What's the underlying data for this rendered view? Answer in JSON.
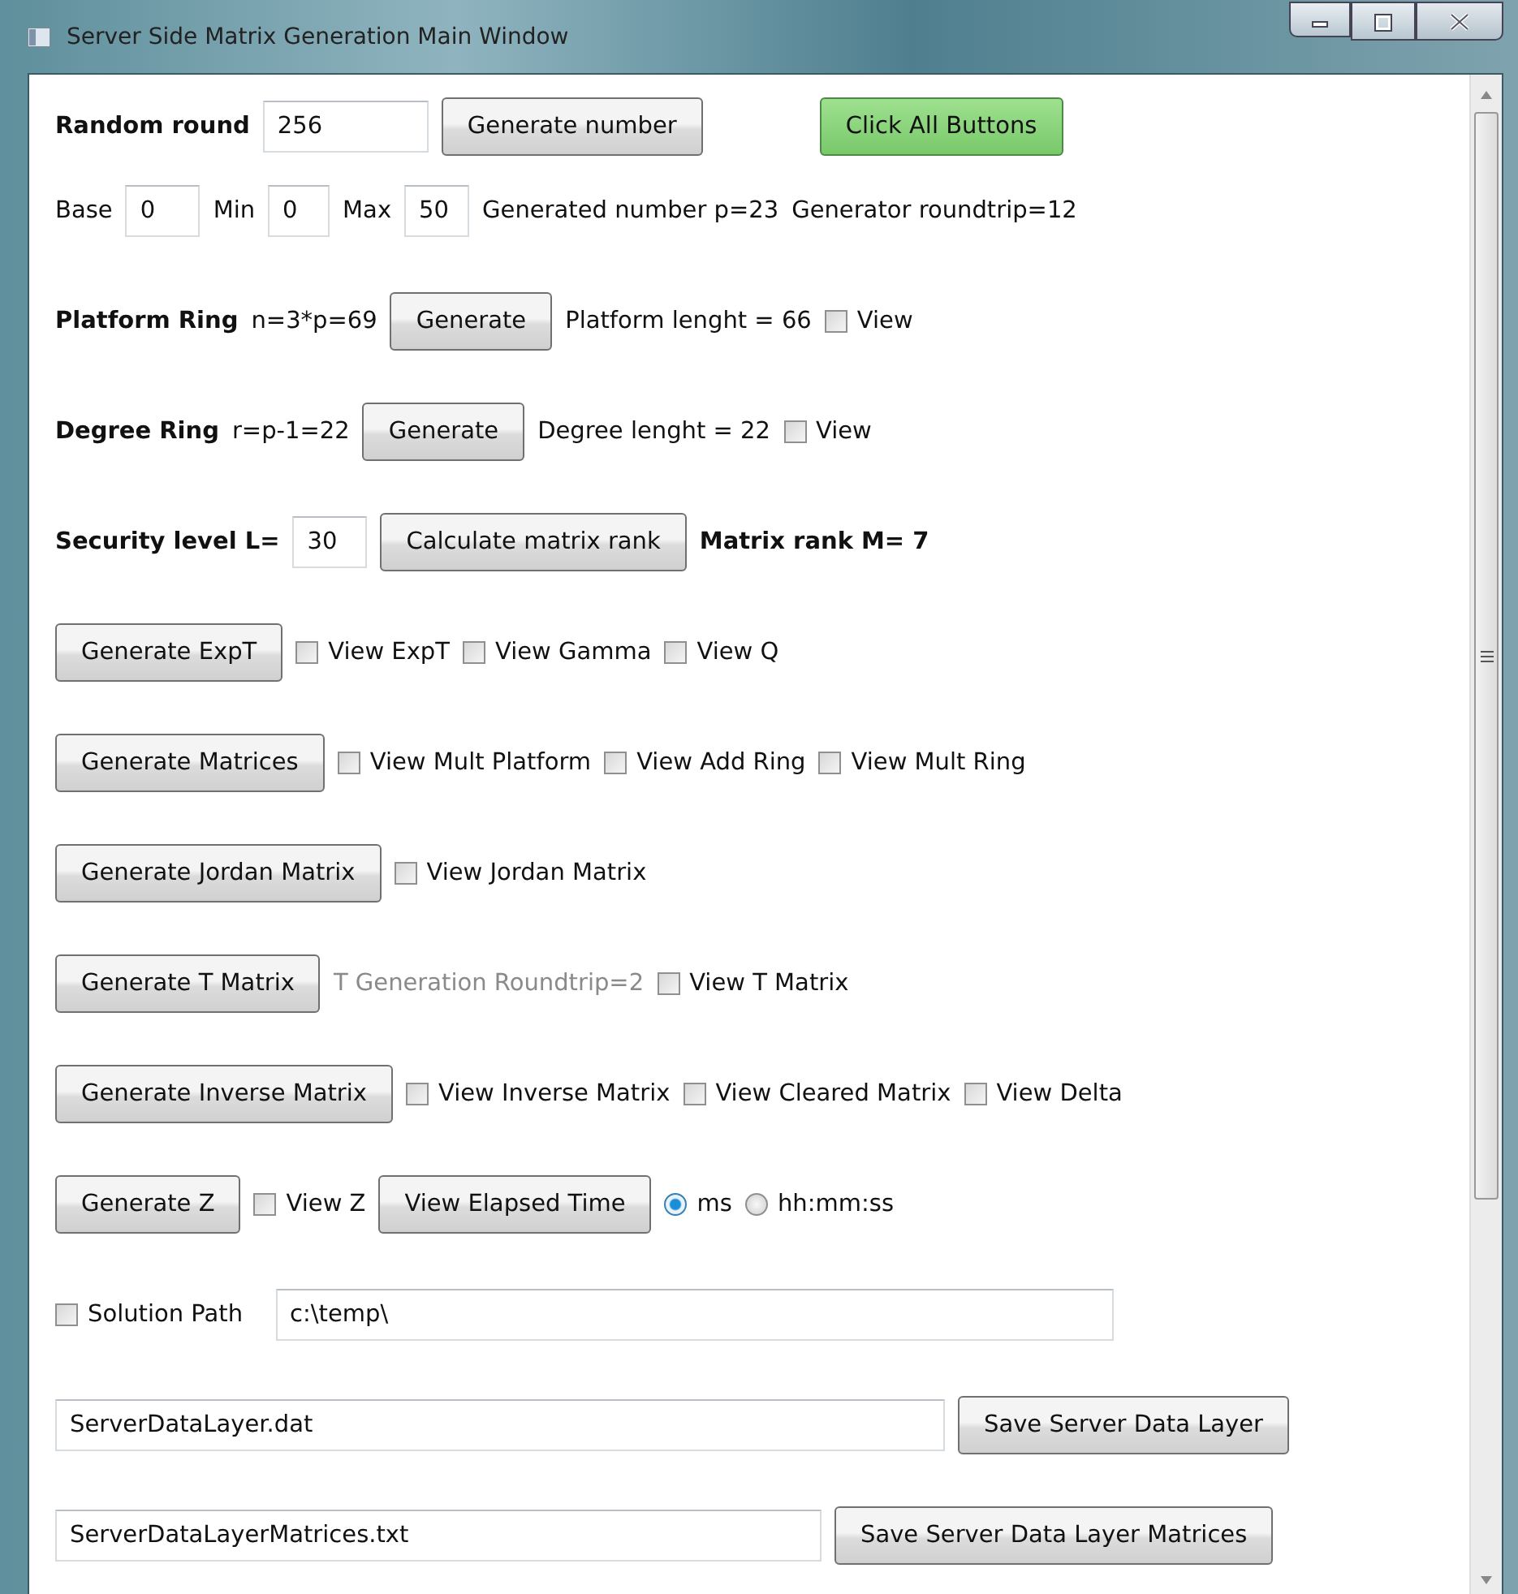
{
  "window": {
    "title": "Server Side Matrix Generation Main Window"
  },
  "rows": [
    {
      "items": [
        {
          "kind": "heading",
          "text": "Random round"
        },
        {
          "kind": "field",
          "value": "256"
        },
        {
          "kind": "button",
          "label": "Generate number"
        },
        {
          "kind": "accent-button",
          "label": "Click All Buttons"
        }
      ]
    },
    {
      "items": [
        {
          "kind": "text",
          "text": "Base"
        },
        {
          "kind": "field",
          "value": "0"
        },
        {
          "kind": "text",
          "text": "Min"
        },
        {
          "kind": "field",
          "value": "0"
        },
        {
          "kind": "text",
          "text": "Max"
        },
        {
          "kind": "field",
          "value": "50"
        },
        {
          "kind": "text",
          "text": "Generated number p=23"
        },
        {
          "kind": "text",
          "text": "Generator roundtrip=12"
        }
      ]
    },
    {
      "items": [
        {
          "kind": "heading",
          "text": "Platform Ring"
        },
        {
          "kind": "text",
          "text": "n=3*p=69"
        },
        {
          "kind": "button",
          "label": "Generate"
        },
        {
          "kind": "text",
          "text": "Platform lenght = 66"
        },
        {
          "kind": "checkbox",
          "label": "View",
          "checked": false
        }
      ]
    },
    {
      "items": [
        {
          "kind": "heading",
          "text": "Degree Ring"
        },
        {
          "kind": "text",
          "text": "r=p-1=22"
        },
        {
          "kind": "button",
          "label": "Generate"
        },
        {
          "kind": "text",
          "text": "Degree lenght = 22"
        },
        {
          "kind": "checkbox",
          "label": "View",
          "checked": false
        }
      ]
    },
    {
      "items": [
        {
          "kind": "heading",
          "text": "Security level L="
        },
        {
          "kind": "field",
          "value": "30"
        },
        {
          "kind": "button",
          "label": "Calculate matrix rank"
        },
        {
          "kind": "heading",
          "text": "Matrix rank M= 7"
        }
      ]
    },
    {
      "items": [
        {
          "kind": "button",
          "label": "Generate ExpT"
        },
        {
          "kind": "checkbox",
          "label": "View ExpT",
          "checked": false
        },
        {
          "kind": "checkbox",
          "label": "View Gamma",
          "checked": false
        },
        {
          "kind": "checkbox",
          "label": "View Q",
          "checked": false
        }
      ]
    },
    {
      "items": [
        {
          "kind": "button",
          "label": "Generate Matrices"
        },
        {
          "kind": "checkbox",
          "label": "View Mult Platform",
          "checked": false
        },
        {
          "kind": "checkbox",
          "label": "View Add Ring",
          "checked": false
        },
        {
          "kind": "checkbox",
          "label": "View Mult Ring",
          "checked": false
        }
      ]
    },
    {
      "items": [
        {
          "kind": "button",
          "label": "Generate Jordan Matrix"
        },
        {
          "kind": "checkbox",
          "label": "View Jordan Matrix",
          "checked": false
        }
      ]
    },
    {
      "items": [
        {
          "kind": "button",
          "label": "Generate T Matrix"
        },
        {
          "kind": "dim-text",
          "text": "T Generation Roundtrip=2"
        },
        {
          "kind": "checkbox",
          "label": "View T Matrix",
          "checked": false
        }
      ]
    },
    {
      "items": [
        {
          "kind": "button",
          "label": "Generate Inverse Matrix"
        },
        {
          "kind": "checkbox",
          "label": "View Inverse Matrix",
          "checked": false
        },
        {
          "kind": "checkbox",
          "label": "View Cleared Matrix",
          "checked": false
        },
        {
          "kind": "checkbox",
          "label": "View Delta",
          "checked": false
        }
      ]
    },
    {
      "items": [
        {
          "kind": "button",
          "label": "Generate Z"
        },
        {
          "kind": "checkbox",
          "label": "View Z",
          "checked": false
        },
        {
          "kind": "button",
          "label": "View Elapsed Time"
        },
        {
          "kind": "radio",
          "label": "ms",
          "selected": true
        },
        {
          "kind": "radio",
          "label": "hh:mm:ss",
          "selected": false
        }
      ]
    },
    {
      "items": [
        {
          "kind": "checkbox",
          "label": "Solution Path",
          "checked": false
        },
        {
          "kind": "field",
          "value": "c:\\temp\\"
        }
      ]
    },
    {
      "items": [
        {
          "kind": "field",
          "value": "ServerDataLayer.dat"
        },
        {
          "kind": "button",
          "label": "Save Server Data Layer"
        }
      ]
    },
    {
      "items": [
        {
          "kind": "field",
          "value": "ServerDataLayerMatrices.txt"
        },
        {
          "kind": "button",
          "label": "Save Server Data Layer Matrices"
        }
      ]
    }
  ]
}
